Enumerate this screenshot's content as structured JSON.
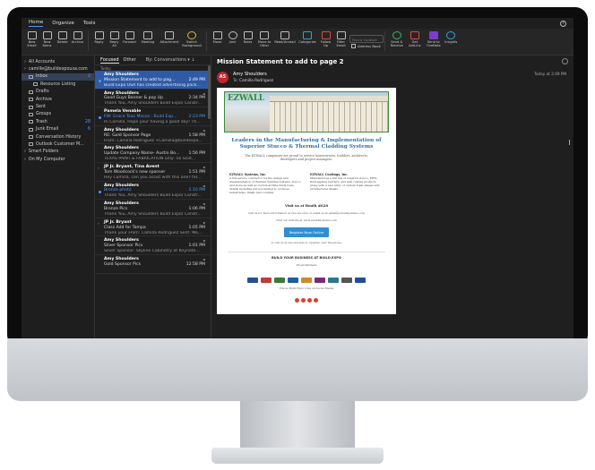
{
  "menubar": {
    "home": "Home",
    "organize": "Organize",
    "tools": "Tools",
    "help": "?"
  },
  "ribbon": {
    "new_email": "New\nEmail",
    "new_items": "New\nItems",
    "delete": "Delete",
    "archive": "Archive",
    "reply": "Reply",
    "reply_all": "Reply\nAll",
    "forward": "Forward",
    "meeting": "Meeting",
    "attachment": "Attachment",
    "switch_background": "Switch\nBackground",
    "move": "Move",
    "junk": "Junk",
    "rules": "Rules",
    "move_to_other": "Move to\nOther",
    "read_unread": "Read/Unread",
    "categorize": "Categorize",
    "follow_up": "Follow\nUp",
    "filter_email": "Filter\nEmail",
    "find_contact": "Find a Contact",
    "address_book": "Address Book",
    "send_receive": "Send &\nReceive",
    "get_addins": "Get\nAdd-ins",
    "send_to_onenote": "Send to\nOneNote",
    "insights": "Insights"
  },
  "folders": [
    {
      "label": "All Accounts",
      "indent": 1,
      "chevron": true
    },
    {
      "label": "camille@buildexpousa.com",
      "indent": 1,
      "chevron": true
    },
    {
      "label": "Inbox",
      "indent": 2,
      "count": "2",
      "selected": true
    },
    {
      "label": "Resource Listing",
      "indent": 3
    },
    {
      "label": "Drafts",
      "indent": 2
    },
    {
      "label": "Archive",
      "indent": 2
    },
    {
      "label": "Sent",
      "indent": 2
    },
    {
      "label": "Groups",
      "indent": 2
    },
    {
      "label": "Trash",
      "indent": 2,
      "count": "28"
    },
    {
      "label": "Junk Email",
      "indent": 2,
      "count": "6"
    },
    {
      "label": "Conversation History",
      "indent": 2
    },
    {
      "label": "Outlook Customer M...",
      "indent": 2
    },
    {
      "label": "Smart Folders",
      "indent": 1,
      "chevron": true
    },
    {
      "label": "On My Computer",
      "indent": 1,
      "chevron": true
    }
  ],
  "list": {
    "tab_focused": "Focused",
    "tab_other": "Other",
    "sort": "By: Conversations ▾ ↓",
    "group": "Today",
    "messages": [
      {
        "from": "Amy Shoulders",
        "subject": "Mission Statement to add to pag...",
        "time": "2:49 PM",
        "preview": "Build Expo USA has created advertising pack...",
        "selected": true,
        "unread": true,
        "clip": false
      },
      {
        "from": "Amy Shoulders",
        "subject": "Good Guys Banner & pop Up",
        "time": "2:34 PM",
        "preview": "Thank You, Amy Shoulders Build Expo/ Constr...",
        "clip": true
      },
      {
        "from": "Pamela Venable",
        "subject": "FW: Grace Tsao Mossa - Build Exp...",
        "time": "2:23 PM",
        "preview": "Hi Camilla, Hope your having a good day! Th...",
        "unread": true,
        "clip": false
      },
      {
        "from": "Amy Shoulders",
        "subject": "RE: Gold Sponsor Page",
        "time": "1:58 PM",
        "preview": "From: Camilla Rodriguez <Camilla@buildexpo...",
        "clip": true
      },
      {
        "from": "Amy Shoulders",
        "subject": "Update Company Name- Austin Bo...",
        "time": "1:56 PM",
        "preview": "TEXAS PAINT & FABRICATION only- no Scot...",
        "clip": false
      },
      {
        "from": "JP Jr. Bryant, Tina Avent",
        "subject": "Tom Woodcock's new sponser",
        "time": "1:51 PM",
        "preview": "Hey Camilla, can you assist with this one? for...",
        "clip": true,
        "chevron": true
      },
      {
        "from": "Amy Shoulders",
        "subject": "Bronze photo",
        "time": "1:10 PM",
        "preview": "Thank You, Amy Shoulders Build Expo/ Constr...",
        "unread": true,
        "clip": true
      },
      {
        "from": "Amy Shoulders",
        "subject": "Bronze Pics",
        "time": "1:06 PM",
        "preview": "Thank You, Amy Shoulders Build Expo/ Constr...",
        "clip": true
      },
      {
        "from": "JP Jr. Bryant",
        "subject": "Class Add for Tampa",
        "time": "1:05 PM",
        "preview": "Thank your From: Camilla Rodriguez Sent: Mo...",
        "clip": true,
        "chevron": true
      },
      {
        "from": "Amy Shoulders",
        "subject": "Silver Sponsor Pics",
        "time": "1:01 PM",
        "preview": "Silver Sponsor- Skyline Cabinetry at Keynote...",
        "clip": true
      },
      {
        "from": "Amy Shoulders",
        "subject": "Gold Sponsor Pics",
        "time": "12:58 PM",
        "preview": "",
        "clip": true
      }
    ]
  },
  "reading": {
    "subject": "Mission Statement to add to page 2",
    "avatar": "AS",
    "sender": "Amy Shoulders",
    "to_label": "To:",
    "to": "Camilla Rodriguez",
    "time": "Today at 2:49 PM",
    "email": {
      "logo": "EZWALL",
      "headline": "Leaders in the Manufacturing & Implementation of Superior Stucco & Thermal Cladding Systems",
      "intro": "The EZWALL companies are proud to service homeowners, builders, architects, developers and project managers.",
      "col1_title": "EZWALL Systems, Inc.",
      "col1": "A full-service contractor for the design and implementation of thermal cladding systems, stucco and stone as well as custom architectural foam details including but not limited to cornices, balustrades, finials and columns.",
      "col2_title": "EZWALL Coatings, Inc.",
      "col2": "Manufactures a full line of superior stucco, EIFS, fluid-applied barriers, and wall coating products along with a vast array of custom foam shapes and architectural details.",
      "visit": "Visit us at Booth #628",
      "call": "Call us for more information at xxx-xxx-xxxx or email us at email@ezwallsystems.com",
      "website": "Visit our website at www.ezwallsystems.com",
      "register": "Register Now Online",
      "register_note": "or call us at xxx-xxx-xxxx to register over the phone.",
      "build": "BUILD YOUR BUSINESS AT BUILD EXPO",
      "presented": "Proud Partners",
      "follow": "Follow Build Expo USA on Social Media"
    }
  },
  "colors": {
    "accent": "#2f5aa5",
    "unread": "#4a9bff",
    "avatar": "#c2262e",
    "logo_green": "#2e8f2e"
  }
}
